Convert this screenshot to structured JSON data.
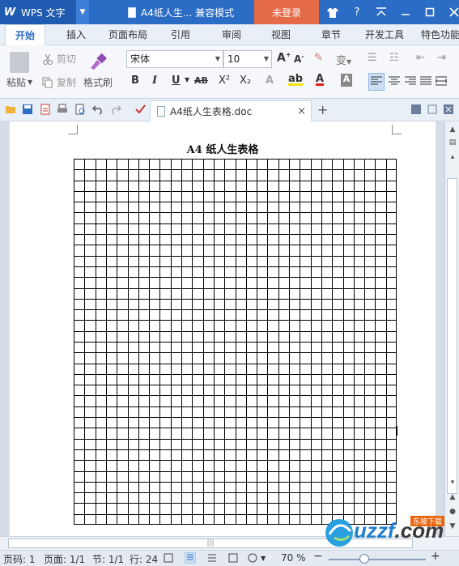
{
  "app": {
    "logo": "W",
    "name": "WPS 文字",
    "doc_title": "A4纸人生... 兼容模式",
    "login_label": "未登录",
    "help_label": "?"
  },
  "tabs": [
    "开始",
    "插入",
    "页面布局",
    "引用",
    "审阅",
    "视图",
    "章节",
    "开发工具",
    "特色功能"
  ],
  "ribbon": {
    "paste_label": "粘贴",
    "cut_label": "剪切",
    "copy_label": "复制",
    "format_painter_label": "格式刷",
    "font_name": "宋体",
    "font_size": "10",
    "bold": "B",
    "italic": "I",
    "underline": "U",
    "strike": "AB",
    "superscript": "X²",
    "subscript": "X₂",
    "phonetic": "变"
  },
  "quickbar": {
    "doc_tab_label": "A4纸人生表格.doc",
    "close_label": "×",
    "new_tab_label": "+"
  },
  "document": {
    "heading": "A4 纸人生表格"
  },
  "grid": {
    "columns": 30,
    "rows": 34
  },
  "status": {
    "page_label": "页码: 1",
    "pages_label": "页面: 1/1",
    "section_label": "节: 1/1",
    "row_label": "行: 24",
    "zoom_label": "70 %",
    "zoom_minus": "−",
    "zoom_plus": "+"
  },
  "watermark": {
    "text": "uzzf",
    "suffix": ".com",
    "badge": "东坡下载"
  },
  "colors": {
    "titlebar": "#2b6cc4",
    "login": "#e56a47",
    "accent": "#2b6cc4"
  }
}
